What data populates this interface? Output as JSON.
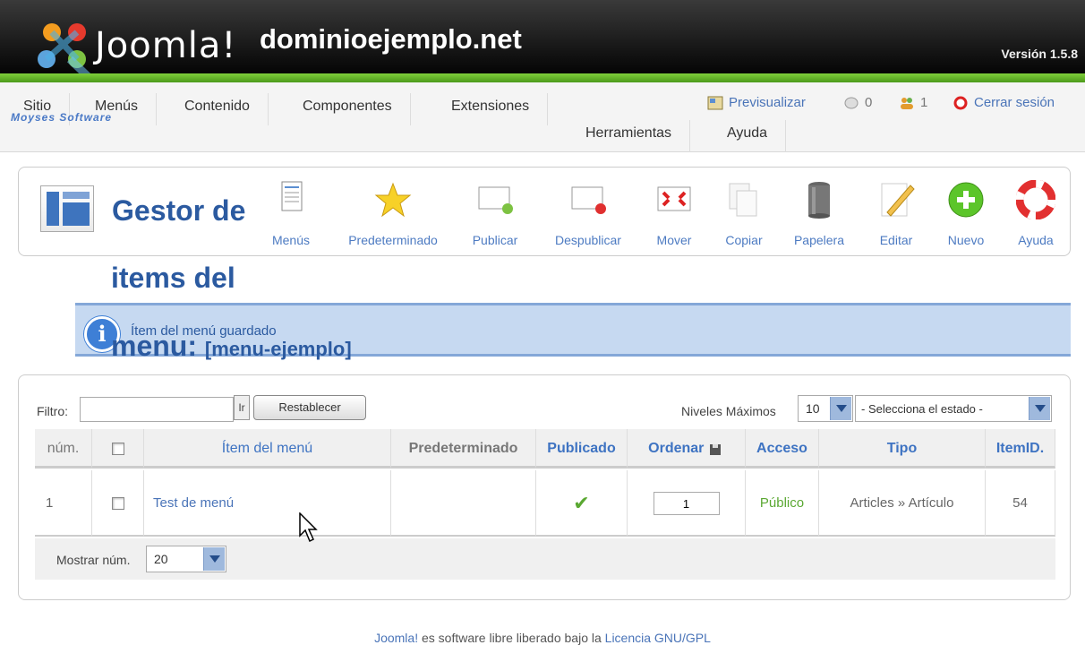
{
  "header": {
    "logo_text": "Joomla!",
    "site_name": "dominioejemplo.net",
    "version": "Versión 1.5.8",
    "brand_sub": "Moyses Software"
  },
  "menu": {
    "items": [
      "Sitio",
      "Menús",
      "Contenido",
      "Componentes",
      "Extensiones",
      "Herramientas",
      "Ayuda"
    ]
  },
  "status": {
    "preview": "Previsualizar",
    "messages_count": "0",
    "users_count": "1",
    "logout": "Cerrar sesión"
  },
  "page": {
    "title_line1": "Gestor de",
    "title_line2": "items del",
    "title_line3": "menu:",
    "title_menu": "[menu-ejemplo]"
  },
  "toolbar": {
    "buttons": [
      "Menús",
      "Predeterminado",
      "Publicar",
      "Despublicar",
      "Mover",
      "Copiar",
      "Papelera",
      "Editar",
      "Nuevo",
      "Ayuda"
    ]
  },
  "message": {
    "text": "Ítem del menú guardado"
  },
  "filter": {
    "label": "Filtro:",
    "value": "",
    "go_label": "Ir",
    "reset_label": "Restablecer",
    "levels_label": "Niveles Máximos",
    "levels_value": "10",
    "state_value": "- Selecciona el estado -"
  },
  "table": {
    "headers": [
      "núm.",
      "",
      "Ítem del menú",
      "Predeterminado",
      "Publicado",
      "Ordenar",
      "Acceso",
      "Tipo",
      "ItemID."
    ],
    "rows": [
      {
        "num": "1",
        "name": "Test de menú",
        "default": "",
        "published": "✔",
        "order": "1",
        "access": "Público",
        "type": "Articles » Artículo",
        "itemid": "54"
      }
    ],
    "show_label": "Mostrar núm.",
    "show_value": "20"
  },
  "footer": {
    "prefix": "Joomla!",
    "middle": " es software libre liberado bajo la ",
    "license": "Licencia GNU/GPL"
  },
  "colors": {
    "accent": "#2b5aa0",
    "link": "#4a74b8",
    "green_bar": "#5fb526",
    "message_bg": "#c6d9f1"
  }
}
